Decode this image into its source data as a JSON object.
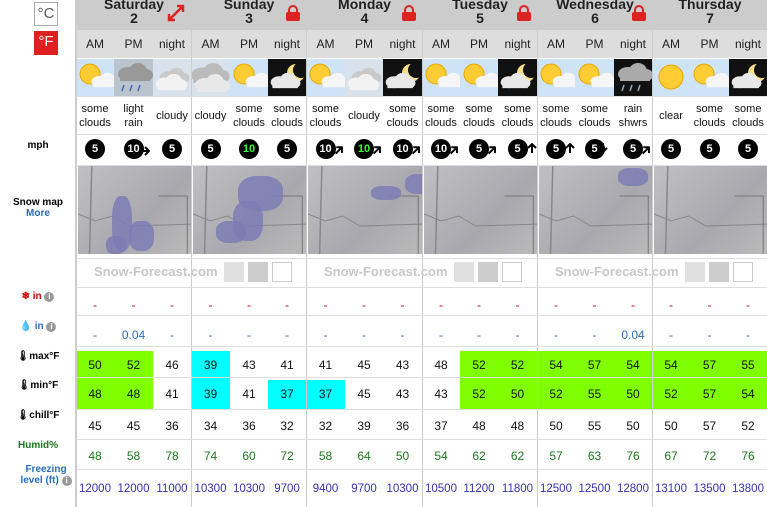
{
  "units": {
    "celsius": "°C",
    "fahrenheit": "°F"
  },
  "days": [
    {
      "name": "Saturday",
      "num": "2",
      "badge": "expand-icon"
    },
    {
      "name": "Sunday",
      "num": "3",
      "badge": "lock-icon"
    },
    {
      "name": "Monday",
      "num": "4",
      "badge": "lock-icon"
    },
    {
      "name": "Tuesday",
      "num": "5",
      "badge": "lock-icon"
    },
    {
      "name": "Wednesday",
      "num": "6",
      "badge": "lock-icon"
    },
    {
      "name": "Thursday",
      "num": "7",
      "badge": ""
    }
  ],
  "periods": [
    "AM",
    "PM",
    "night",
    "AM",
    "PM",
    "night",
    "AM",
    "PM",
    "night",
    "AM",
    "PM",
    "night",
    "AM",
    "PM",
    "night",
    "AM",
    "PM",
    "night"
  ],
  "weather": [
    {
      "text": "some clouds",
      "icon": "sun-cloud"
    },
    {
      "text": "light rain",
      "icon": "rain"
    },
    {
      "text": "cloudy",
      "icon": "cloud"
    },
    {
      "text": "cloudy",
      "icon": "overcast"
    },
    {
      "text": "some clouds",
      "icon": "sun-cloud"
    },
    {
      "text": "some clouds",
      "icon": "moon-cloud"
    },
    {
      "text": "some clouds",
      "icon": "sun-cloud"
    },
    {
      "text": "cloudy",
      "icon": "cloud"
    },
    {
      "text": "some clouds",
      "icon": "moon-cloud"
    },
    {
      "text": "some clouds",
      "icon": "sun-cloud"
    },
    {
      "text": "some clouds",
      "icon": "sun-cloud"
    },
    {
      "text": "some clouds",
      "icon": "moon-cloud"
    },
    {
      "text": "some clouds",
      "icon": "sun-cloud"
    },
    {
      "text": "some clouds",
      "icon": "sun-cloud"
    },
    {
      "text": "rain shwrs",
      "icon": "rain-night"
    },
    {
      "text": "clear",
      "icon": "sun"
    },
    {
      "text": "some clouds",
      "icon": "sun-cloud"
    },
    {
      "text": "some clouds",
      "icon": "moon-cloud"
    }
  ],
  "labels": {
    "wind": "mph",
    "snow_map": "Snow map",
    "snow_map_more": "More",
    "snow_in": "in",
    "rain_in": "in",
    "max": "max°F",
    "min": "min°F",
    "chill": "chill°F",
    "humid": "Humid%",
    "freezing": "Freezing level (ft)",
    "watermark": "Snow-Forecast.com"
  },
  "wind_speed": [
    5,
    10,
    5,
    5,
    10,
    5,
    10,
    10,
    10,
    10,
    5,
    5,
    5,
    5,
    5,
    5,
    5,
    5
  ],
  "wind_highlight": [
    false,
    false,
    false,
    false,
    true,
    false,
    false,
    true,
    false,
    false,
    false,
    false,
    false,
    false,
    false,
    false,
    false,
    false
  ],
  "wind_dir": [
    "",
    "E",
    "",
    "",
    "",
    "",
    "NE",
    "NE",
    "NE",
    "NE",
    "NE",
    "N",
    "N",
    "S",
    "NE",
    "",
    "",
    ""
  ],
  "snow": [
    "-",
    "-",
    "-",
    "-",
    "-",
    "-",
    "-",
    "-",
    "-",
    "-",
    "-",
    "-",
    "-",
    "-",
    "-",
    "-",
    "-",
    "-"
  ],
  "rain": [
    "-",
    "0.04",
    "-",
    "-",
    "-",
    "-",
    "-",
    "-",
    "-",
    "-",
    "-",
    "-",
    "-",
    "-",
    "0.04",
    "-",
    "-",
    "-"
  ],
  "max": [
    "50",
    "52",
    "46",
    "39",
    "43",
    "41",
    "41",
    "45",
    "43",
    "48",
    "52",
    "52",
    "54",
    "57",
    "54",
    "54",
    "57",
    "55"
  ],
  "min": [
    "48",
    "48",
    "41",
    "39",
    "41",
    "37",
    "37",
    "45",
    "43",
    "43",
    "52",
    "50",
    "52",
    "55",
    "50",
    "52",
    "57",
    "54"
  ],
  "chill": [
    "45",
    "45",
    "36",
    "34",
    "36",
    "32",
    "32",
    "39",
    "36",
    "37",
    "48",
    "48",
    "50",
    "55",
    "50",
    "50",
    "57",
    "52"
  ],
  "humid": [
    "48",
    "58",
    "78",
    "74",
    "60",
    "72",
    "58",
    "64",
    "50",
    "54",
    "62",
    "62",
    "57",
    "63",
    "76",
    "67",
    "72",
    "76"
  ],
  "freezing": [
    "12000",
    "12000",
    "11000",
    "10300",
    "10300",
    "9700",
    "9400",
    "9700",
    "10300",
    "10500",
    "11200",
    "11800",
    "12500",
    "12500",
    "12800",
    "13100",
    "13500",
    "13800"
  ]
}
